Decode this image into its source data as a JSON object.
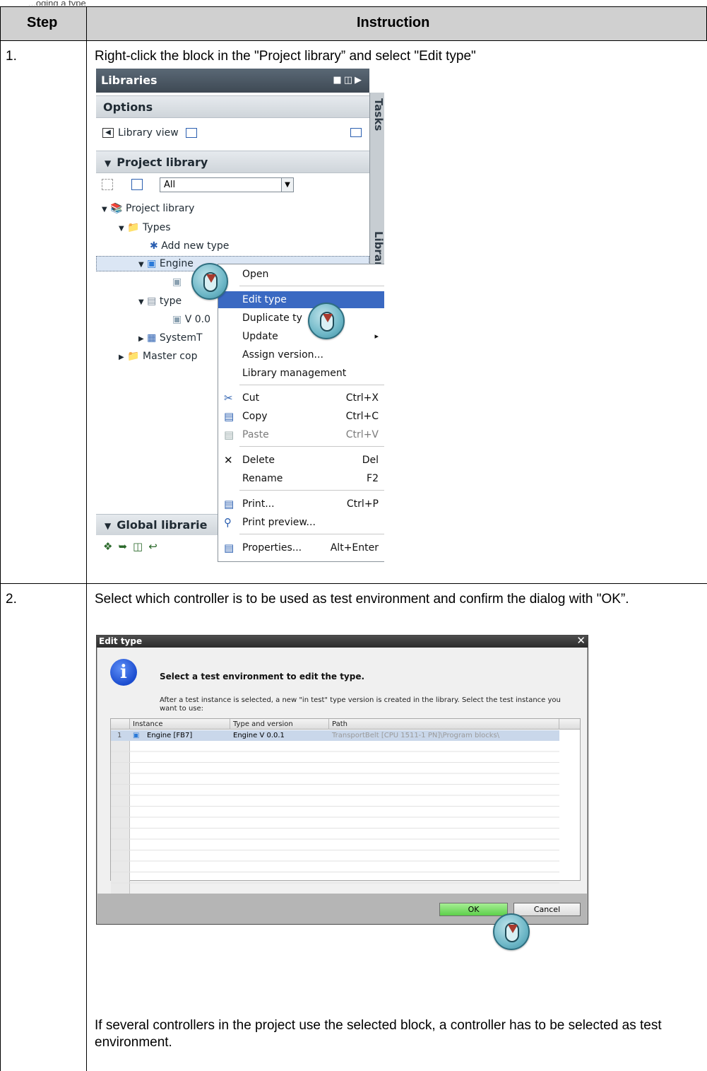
{
  "document": {
    "top_fragment": "...oging a type",
    "table": {
      "header_step": "Step",
      "header_instruction": "Instruction",
      "rows": [
        {
          "step": "1.",
          "text": "Right-click the block in the \"Project library” and select \"Edit type\""
        },
        {
          "step": "2.",
          "text": "Select which controller is to be used as test environment and confirm the dialog with \"OK”.",
          "note": "If several controllers in the project use the selected block, a controller has to be selected as test environment."
        }
      ]
    }
  },
  "libraries_panel": {
    "title": "Libraries",
    "options_label": "Options",
    "library_view_label": "Library view",
    "project_library_header": "Project library",
    "filter_value": "All",
    "side_tabs": [
      "Tasks",
      "Libraries"
    ],
    "tree": {
      "project_library": "Project library",
      "types": "Types",
      "add_new_type": "Add new type",
      "engine": "Engine",
      "type_partial": "type",
      "version_partial": "V 0.0",
      "system_partial": "SystemT",
      "master_copies_partial": "Master cop"
    },
    "global_libraries_header": "Global librarie",
    "icons": {
      "title_bar": [
        "restore-icon",
        "split-icon",
        "collapse-arrow-icon"
      ],
      "global_tools": [
        "new-library-icon",
        "open-library-icon",
        "save-library-icon",
        "close-library-icon"
      ]
    }
  },
  "context_menu": {
    "items": [
      {
        "label": "Open",
        "shortcut": ""
      },
      {
        "label": "Edit type",
        "shortcut": ""
      },
      {
        "label": "Duplicate ty",
        "shortcut": ""
      },
      {
        "label": "Update",
        "shortcut": ""
      },
      {
        "label": "Assign version...",
        "shortcut": ""
      },
      {
        "label": "Library management",
        "shortcut": ""
      },
      {
        "label": "Cut",
        "shortcut": "Ctrl+X"
      },
      {
        "label": "Copy",
        "shortcut": "Ctrl+C"
      },
      {
        "label": "Paste",
        "shortcut": "Ctrl+V"
      },
      {
        "label": "Delete",
        "shortcut": "Del"
      },
      {
        "label": "Rename",
        "shortcut": "F2"
      },
      {
        "label": "Print...",
        "shortcut": "Ctrl+P"
      },
      {
        "label": "Print preview...",
        "shortcut": ""
      },
      {
        "label": "Properties...",
        "shortcut": "Alt+Enter"
      }
    ],
    "highlighted_item": "Edit type",
    "submenu_arrow": "▸"
  },
  "edit_type_dialog": {
    "title": "Edit type",
    "close_glyph": "✕",
    "info_glyph": "i",
    "heading": "Select a test environment to edit the type.",
    "description": "After a test instance is selected, a new \"in test\" type version is created in the library. Select the test instance you want to use:",
    "columns": [
      "Instance",
      "Type and version",
      "Path"
    ],
    "rows": [
      {
        "num": "1",
        "instance": "Engine [FB7]",
        "type_version": "Engine V 0.0.1",
        "path": "TransportBelt [CPU 1511-1 PN]\\Program blocks\\"
      }
    ],
    "ok_label": "OK",
    "cancel_label": "Cancel"
  },
  "colors": {
    "header_bg": "#d0d0d0",
    "menu_highlight": "#3a69c2",
    "ok_button": "#5dcf4a",
    "row_selected": "#c9d7ea"
  }
}
